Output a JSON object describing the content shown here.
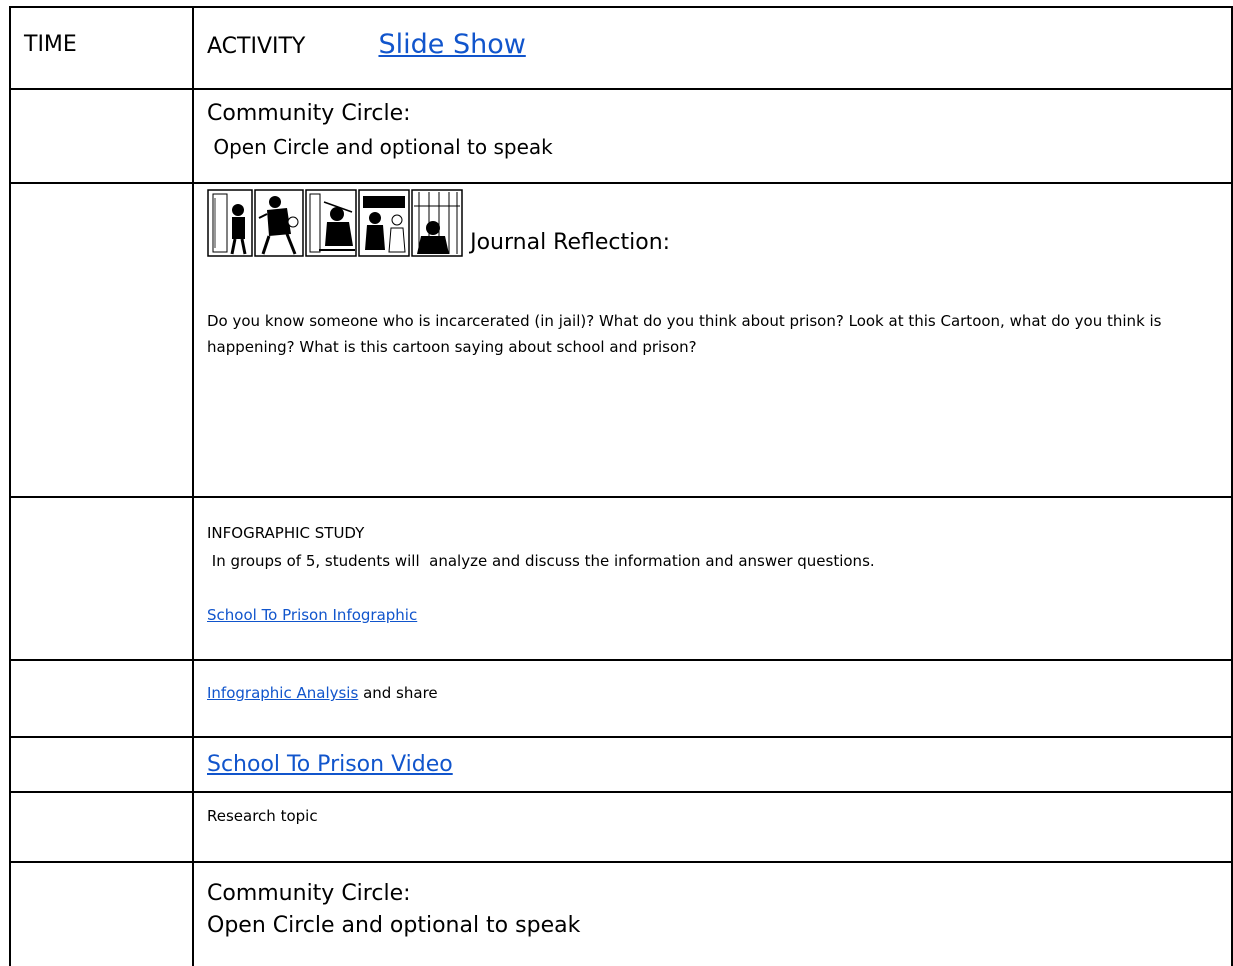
{
  "header": {
    "time": "TIME",
    "activity": "ACTIVITY",
    "slide_show_link": "Slide Show"
  },
  "rows": {
    "community_circle_1": {
      "title": "Community Circle:",
      "text": " Open Circle and optional to speak"
    },
    "journal": {
      "title": "Journal Reflection:",
      "prompt": "Do you know someone who is incarcerated (in jail)?  What do you think about prison?  Look at this Cartoon, what do you think is happening?  What is this cartoon saying about school and prison?"
    },
    "infographic_study": {
      "title": "INFOGRAPHIC STUDY",
      "text": " In groups of 5, students will  analyze and discuss the information and answer questions.",
      "link": "School To Prison Infographic"
    },
    "analysis": {
      "link": "Infographic Analysis",
      "suffix": " and share"
    },
    "video": {
      "link": "School To Prison Video"
    },
    "research": {
      "text": "Research topic"
    },
    "community_circle_2": {
      "title": "Community Circle:",
      "text": "Open Circle and optional to speak"
    }
  }
}
